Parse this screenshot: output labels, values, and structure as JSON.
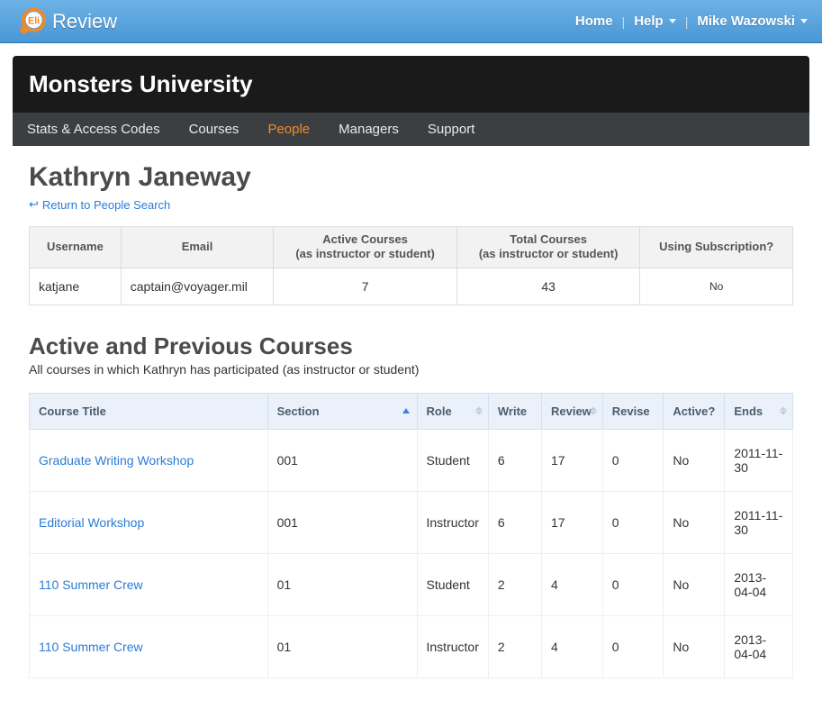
{
  "topnav": {
    "home": "Home",
    "help": "Help",
    "user": "Mike Wazowski"
  },
  "brand": {
    "text": "Review"
  },
  "org": {
    "name": "Monsters University"
  },
  "tabs": [
    {
      "id": "stats",
      "label": "Stats & Access Codes",
      "active": false
    },
    {
      "id": "courses",
      "label": "Courses",
      "active": false
    },
    {
      "id": "people",
      "label": "People",
      "active": true
    },
    {
      "id": "managers",
      "label": "Managers",
      "active": false
    },
    {
      "id": "support",
      "label": "Support",
      "active": false
    }
  ],
  "person": {
    "name": "Kathryn Janeway",
    "back_link": "Return to People Search"
  },
  "summary": {
    "headers": {
      "username": "Username",
      "email": "Email",
      "active_courses": "Active Courses\n(as instructor or student)",
      "total_courses": "Total Courses\n(as instructor or student)",
      "subscription": "Using Subscription?"
    },
    "row": {
      "username": "katjane",
      "email": "captain@voyager.mil",
      "active_courses": "7",
      "total_courses": "43",
      "subscription": "No"
    }
  },
  "courses_section": {
    "heading": "Active and Previous Courses",
    "sub": "All courses in which Kathryn has participated (as instructor or student)"
  },
  "courses_table": {
    "headers": {
      "title": "Course Title",
      "section": "Section",
      "role": "Role",
      "write": "Write",
      "review": "Review",
      "revise": "Revise",
      "active": "Active?",
      "ends": "Ends"
    },
    "rows": [
      {
        "title": "Graduate Writing Workshop",
        "section": "001",
        "role": "Student",
        "write": "6",
        "review": "17",
        "revise": "0",
        "active": "No",
        "ends": "2011-11-30"
      },
      {
        "title": "Editorial Workshop",
        "section": "001",
        "role": "Instructor",
        "write": "6",
        "review": "17",
        "revise": "0",
        "active": "No",
        "ends": "2011-11-30"
      },
      {
        "title": "110 Summer Crew",
        "section": "01",
        "role": "Student",
        "write": "2",
        "review": "4",
        "revise": "0",
        "active": "No",
        "ends": "2013-04-04"
      },
      {
        "title": "110 Summer Crew",
        "section": "01",
        "role": "Instructor",
        "write": "2",
        "review": "4",
        "revise": "0",
        "active": "No",
        "ends": "2013-04-04"
      }
    ]
  }
}
